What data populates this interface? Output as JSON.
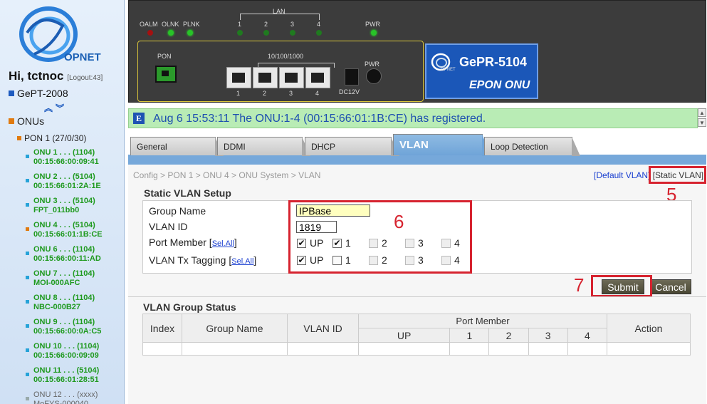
{
  "sidebar": {
    "brand": "OPNET",
    "greeting": "Hi, tctnoc",
    "logout": "[Logout:43]",
    "device": "GePT-2008",
    "onus_label": "ONUs",
    "pon_label": "PON 1 (27/0/30)",
    "onus": [
      {
        "line1": "ONU 1 . . . (1104)",
        "line2": "00:15:66:00:09:41",
        "status": "online"
      },
      {
        "line1": "ONU 2 . . . (5104)",
        "line2": "00:15:66:01:2A:1E",
        "status": "online"
      },
      {
        "line1": "ONU 3 . . . (5104)",
        "line2": "FPT_011bb0",
        "status": "online"
      },
      {
        "line1": "ONU 4 . . . (5104)",
        "line2": "00:15:66:01:1B:CE",
        "status": "selected"
      },
      {
        "line1": "ONU 6 . . . (1104)",
        "line2": "00:15:66:00:11:AD",
        "status": "online"
      },
      {
        "line1": "ONU 7 . . . (1104)",
        "line2": "MOI-000AFC",
        "status": "online"
      },
      {
        "line1": "ONU 8 . . . (1104)",
        "line2": "NBC-000B27",
        "status": "online"
      },
      {
        "line1": "ONU 9 . . . (1104)",
        "line2": "00:15:66:00:0A:C5",
        "status": "online"
      },
      {
        "line1": "ONU 10 . . . (1104)",
        "line2": "00:15:66:00:09:09",
        "status": "online"
      },
      {
        "line1": "ONU 11 . . . (5104)",
        "line2": "00:15:66:01:28:51",
        "status": "online"
      },
      {
        "line1": "ONU 12 . . . (xxxx)",
        "line2": "MoFYS-000040",
        "status": "offline"
      }
    ]
  },
  "panel": {
    "leds": {
      "oalm": "OALM",
      "olnk": "OLNK",
      "plnk": "PLNK",
      "lan": "LAN",
      "pwr": "PWR"
    },
    "lan_ports": [
      "1",
      "2",
      "3",
      "4"
    ],
    "pon_label": "PON",
    "speed_label": "10/100/1000",
    "dc_label": "DC12V",
    "pwr_label": "PWR",
    "model": "GePR-5104",
    "model_sub": "EPON ONU",
    "mini_brand": "OPNET"
  },
  "notification": {
    "icon": "E",
    "text": "Aug 6 15:53:11  The ONU:1-4 (00:15:66:01:1B:CE) has registered."
  },
  "tabs": [
    {
      "label": "General"
    },
    {
      "label": "DDMI"
    },
    {
      "label": "DHCP"
    },
    {
      "label": "VLAN",
      "active": true
    },
    {
      "label": "Loop Detection"
    }
  ],
  "breadcrumb": "Config > PON 1 > ONU 4 > ONU System > VLAN",
  "vlan_links": {
    "default": "[Default VLAN]",
    "static": "[Static VLAN]"
  },
  "setup": {
    "title": "Static VLAN Setup",
    "group_name_label": "Group Name",
    "group_name_value": "IPBase",
    "vlan_id_label": "VLAN ID",
    "vlan_id_value": "1819",
    "port_member_label": "Port Member",
    "tx_tagging_label": "VLAN Tx Tagging",
    "sel_all": "Sel.All",
    "port_labels": [
      "UP",
      "1",
      "2",
      "3",
      "4"
    ],
    "port_member_checked": [
      true,
      true,
      false,
      false,
      false
    ],
    "tx_tagging_checked": [
      true,
      false,
      false,
      false,
      false
    ],
    "submit": "Submit",
    "cancel": "Cancel"
  },
  "annotations": {
    "five": "5",
    "six": "6",
    "seven": "7"
  },
  "status": {
    "title": "VLAN Group Status",
    "col_index": "Index",
    "col_group": "Group Name",
    "col_vlan": "VLAN ID",
    "col_port_member": "Port Member",
    "col_action": "Action",
    "port_cols": [
      "UP",
      "1",
      "2",
      "3",
      "4"
    ]
  },
  "colors": {
    "accent": "#1b57b8",
    "annotation": "#d6232f",
    "online": "#1f9a1f",
    "notification_bg": "#b9ecb5"
  }
}
